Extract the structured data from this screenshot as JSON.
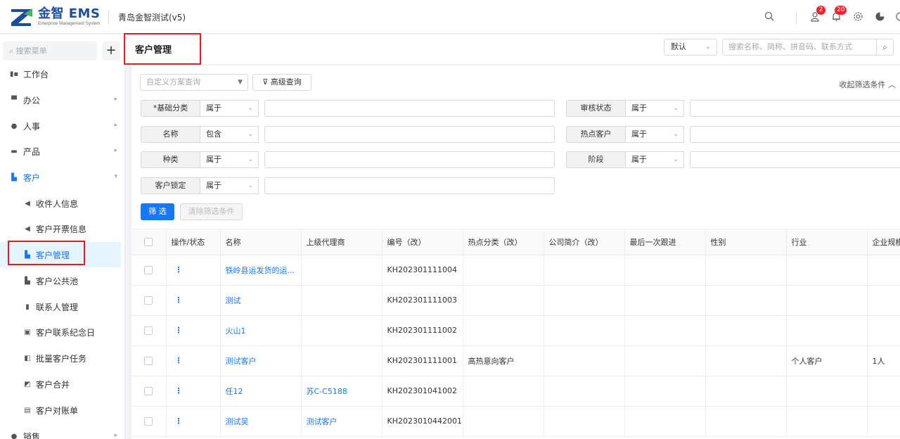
{
  "brand": {
    "name": "金智 EMS",
    "subtitle": "Enterprise Management System",
    "company": "青岛金智测试(v5)"
  },
  "header_icons": [
    {
      "name": "search-icon"
    },
    {
      "name": "user-tasks-icon",
      "badge": "2"
    },
    {
      "name": "bell-icon",
      "badge": "20"
    },
    {
      "name": "gear-icon"
    },
    {
      "name": "pie-chart-icon"
    },
    {
      "name": "power-icon"
    }
  ],
  "sidebar": {
    "search_placeholder": "搜索菜单",
    "add_label": "+",
    "items": [
      {
        "label": "工作台",
        "icon": "dashboard-icon",
        "level": 1
      },
      {
        "label": "办公",
        "icon": "office-icon",
        "level": 1,
        "arrow": "▸"
      },
      {
        "label": "人事",
        "icon": "people-icon",
        "level": 1,
        "arrow": "▸"
      },
      {
        "label": "产品",
        "icon": "product-icon",
        "level": 1,
        "arrow": "▸"
      },
      {
        "label": "客户",
        "icon": "customer-icon",
        "level": 1,
        "arrow": "▾",
        "expanded": true
      },
      {
        "label": "收件人信息",
        "icon": "speaker-icon",
        "level": 2
      },
      {
        "label": "客户开票信息",
        "icon": "speaker-icon",
        "level": 2
      },
      {
        "label": "客户管理",
        "icon": "building-icon",
        "level": 2,
        "active": true
      },
      {
        "label": "客户公共池",
        "icon": "building-icon",
        "level": 2
      },
      {
        "label": "联系人管理",
        "icon": "contact-card-icon",
        "level": 2
      },
      {
        "label": "客户联系纪念日",
        "icon": "calendar-icon",
        "level": 2
      },
      {
        "label": "批量客户任务",
        "icon": "stack-icon",
        "level": 2
      },
      {
        "label": "客户合并",
        "icon": "merge-icon",
        "level": 2
      },
      {
        "label": "客户对账单",
        "icon": "statement-icon",
        "level": 2
      },
      {
        "label": "销售",
        "icon": "sales-icon",
        "level": 1,
        "arrow": "▸"
      }
    ]
  },
  "page": {
    "title": "客户管理",
    "view_select": "默认",
    "search_placeholder": "搜索名称、简称、拼音码、联系方式"
  },
  "filter": {
    "scheme_placeholder": "自定义方案查询",
    "advanced_label": "高级查询",
    "collapse_label": "收起筛选条件",
    "left_fields": [
      {
        "label": "*基础分类",
        "op": "属于"
      },
      {
        "label": "名称",
        "op": "包含"
      },
      {
        "label": "种类",
        "op": "属于"
      },
      {
        "label": "客户锁定",
        "op": "属于"
      }
    ],
    "right_fields": [
      {
        "label": "审核状态",
        "op": "属于"
      },
      {
        "label": "热点客户",
        "op": "属于"
      },
      {
        "label": "阶段",
        "op": "属于"
      }
    ],
    "filter_button": "筛 选",
    "clear_button": "清除筛选条件"
  },
  "table": {
    "columns": [
      "操作/状态",
      "名称",
      "上级代理商",
      "编号（改）",
      "热点分类（改）",
      "公司简介（改）",
      "最后一次跟进",
      "性别",
      "行业",
      "企业规模"
    ],
    "rows": [
      {
        "action": "⋮",
        "name": "铁岭县运发货的运...",
        "agent": "",
        "code": "KH202301111004",
        "hot": "",
        "intro": "",
        "last": "",
        "gender": "",
        "industry": "",
        "size": ""
      },
      {
        "action": "⋮",
        "name": "测试",
        "agent": "",
        "code": "KH202301111003",
        "hot": "",
        "intro": "",
        "last": "",
        "gender": "",
        "industry": "",
        "size": ""
      },
      {
        "action": "⋮",
        "name": "火山1",
        "agent": "",
        "code": "KH202301111002",
        "hot": "",
        "intro": "",
        "last": "",
        "gender": "",
        "industry": "",
        "size": ""
      },
      {
        "action": "⋮",
        "name": "测试客户",
        "agent": "",
        "code": "KH202301111001",
        "hot": "高热意向客户",
        "intro": "",
        "last": "",
        "gender": "",
        "industry": "个人客户",
        "size": "1人"
      },
      {
        "action": "⋮",
        "name": "任12",
        "agent": "苏C-C5188",
        "code": "KH202301041002",
        "hot": "",
        "intro": "",
        "last": "",
        "gender": "",
        "industry": "",
        "size": ""
      },
      {
        "action": "⋮",
        "name": "测试吴",
        "agent": "测试客户",
        "code": "KH2023010442001",
        "hot": "",
        "intro": "",
        "last": "",
        "gender": "",
        "industry": "",
        "size": ""
      }
    ]
  }
}
